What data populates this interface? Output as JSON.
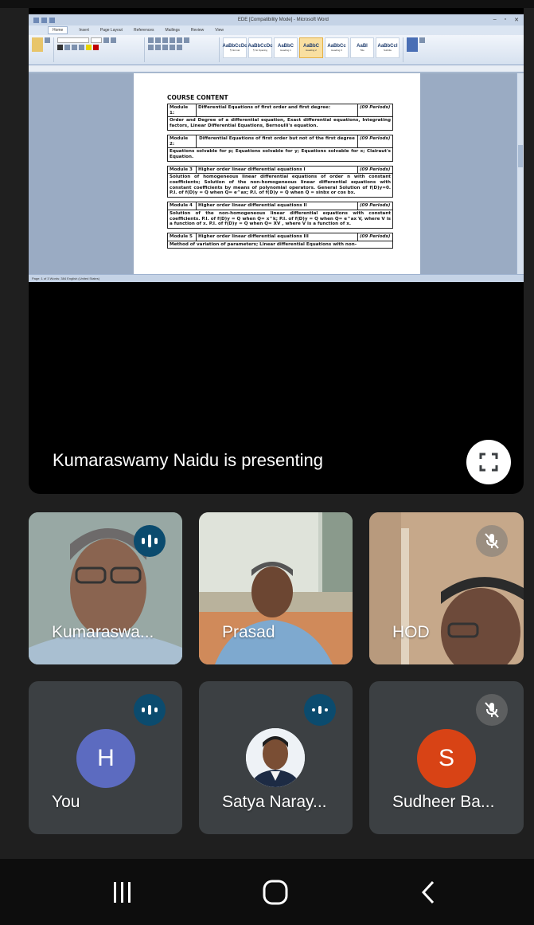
{
  "presentation": {
    "window_title": "EDE [Compatibility Mode] - Microsoft Word",
    "ribbon_tabs": [
      "Home",
      "Insert",
      "Page Layout",
      "References",
      "Mailings",
      "Review",
      "View"
    ],
    "styles": [
      {
        "sample": "AaBbCcDc",
        "name": "¶ Normal"
      },
      {
        "sample": "AaBbCcDc",
        "name": "¶ No Spacing"
      },
      {
        "sample": "AaBbC",
        "name": "Heading 1"
      },
      {
        "sample": "AaBbC",
        "name": "Heading 2"
      },
      {
        "sample": "AaBbCc",
        "name": "Heading 3"
      },
      {
        "sample": "AaBI",
        "name": "Title"
      },
      {
        "sample": "AaBbCcI",
        "name": "Subtitle"
      }
    ],
    "document": {
      "heading": "COURSE CONTENT",
      "modules": [
        {
          "label": "Module 1:",
          "title": "Differential Equations of first order and first degree:",
          "periods": "(09 Periods)",
          "description": "Order and Degree of a differential equation, Exact differential equations, Integrating factors, Linear Differential Equations, Bernoulli's equation."
        },
        {
          "label": "Module 2:",
          "title": "Differential Equations of first order but not of the first degree",
          "periods": "(09 Periods)",
          "description": "Equations solvable for p; Equations solvable for y; Equations solvable for x; Clairaut's Equation."
        },
        {
          "label": "Module 3",
          "title": "Higher order linear differential equations I",
          "periods": "(09 Periods)",
          "description": "Solution of homogeneous linear differential equations of order n with constant coefficients; Solution of the non-homogeneous linear differential equations with constant coefficients by means of polynomial operators. General Solution of f(D)y=0. P.I. of f(D)y = Q when Q= e^ax; P.I. of f(D)y = Q when Q = sinbx or cos bx."
        },
        {
          "label": "Module 4",
          "title": "Higher order linear differential equations II",
          "periods": "(09 Periods)",
          "description": "Solution of the non-homogeneous linear differential equations with constant coefficients. P.I. of f(D)y = Q when Q= x^k; P.I. of f(D)y = Q when Q= e^ax V, where V is a function of x. P.I. of f(D)y = Q when Q= XV , where V is a function of x."
        },
        {
          "label": "Module 5",
          "title": "Higher order linear differential equations III",
          "periods": "(09 Periods)",
          "description": "Method of variation of parameters; Linear differential Equations with non-"
        }
      ]
    },
    "status_text": "Page: 1 of 3   Words: 384   English (United States)"
  },
  "presenter_label": "Kumaraswamy Naidu is presenting",
  "participants": [
    {
      "name": "Kumaraswa...",
      "state": "speaking"
    },
    {
      "name": "Prasad",
      "state": "none"
    },
    {
      "name": "HOD",
      "state": "muted"
    },
    {
      "name": "You",
      "initial": "H",
      "state": "speaking",
      "color": "#5c6bc0"
    },
    {
      "name": "Satya Naray...",
      "state": "speaking"
    },
    {
      "name": "Sudheer Ba...",
      "initial": "S",
      "state": "muted",
      "color": "#d84315"
    }
  ],
  "icons": {
    "fullscreen": "fullscreen-icon",
    "speaking": "audio-level-icon",
    "muted": "mic-off-icon",
    "nav_recents": "recents-icon",
    "nav_home": "home-icon",
    "nav_back": "back-icon"
  },
  "colors": {
    "background": "#1f1f1f",
    "tile": "#3c4043",
    "speaking_badge": "#0b4b6e"
  }
}
